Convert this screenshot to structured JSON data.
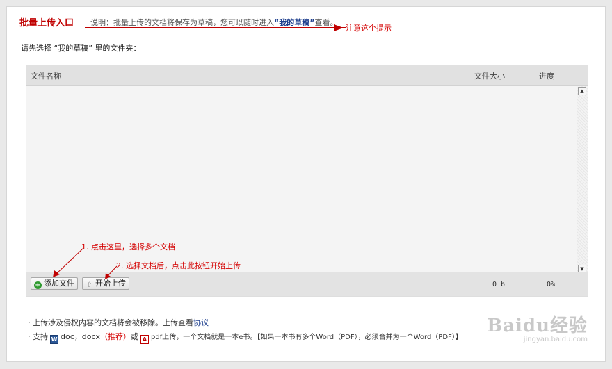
{
  "header": {
    "title": "批量上传入口",
    "desc_prefix": "说明：批量上传的文档将保存为草稿，您可以随时进入",
    "desc_draft": "“我的草稿”",
    "desc_suffix": "查看。",
    "note": "注意这个提示"
  },
  "choose_label": "请先选择 “我的草稿” 里的文件夹：",
  "uploader": {
    "columns": {
      "name": "文件名称",
      "size": "文件大小",
      "progress": "进度"
    },
    "add_button": "添加文件",
    "upload_button": "开始上传",
    "total_size": "0 b",
    "total_progress": "0%",
    "scroll_up": "▲",
    "scroll_down": "▼"
  },
  "annotations": {
    "step1": "1. 点击这里，选择多个文档",
    "step2": "2. 选择文档后，点击此按钮开始上传"
  },
  "footnotes": {
    "line1_text": "· 上传涉及侵权内容的文档将会被移除。上传查看",
    "line1_link": "协议",
    "line2_prefix": "· 支持",
    "word_icon_glyph": "W",
    "line2_formats": "doc，docx",
    "line2_recommend": "（推荐）",
    "line2_or": "或",
    "pdf_icon_glyph": "A",
    "line2_suffix": "pdf上传，一个文档就是一本e书。【如果一本书有多个Word（PDF），必须合并为一个Word（PDF）】"
  },
  "watermark": {
    "brand": "Baidu经验",
    "url": "jingyan.baidu.com"
  },
  "colors": {
    "accent_red": "#c00000",
    "link_blue": "#1e3f8e",
    "annotation_red": "#d40000"
  }
}
